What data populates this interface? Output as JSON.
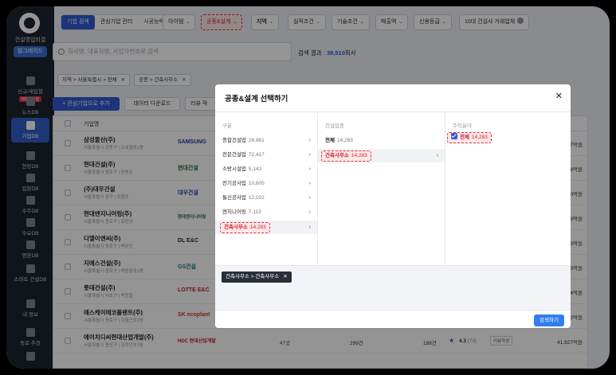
{
  "sidebar": {
    "logo_text": "건설영업비결",
    "pill": "빌그레이드",
    "items": [
      {
        "label": "신규/새입찰",
        "badge": "NEW 오늘"
      },
      {
        "label": "뉴스DB"
      },
      {
        "label": "기업DB"
      },
      {
        "label": "현장DB"
      },
      {
        "label": "입찰DB"
      },
      {
        "label": "수주DB"
      },
      {
        "label": "수요DB"
      },
      {
        "label": "평판DB"
      },
      {
        "label": "스마트 건설DB"
      },
      {
        "label": "내 정보"
      },
      {
        "label": "동료 추천"
      }
    ]
  },
  "topbar": {
    "tabs": [
      "기업 검색",
      "관심기업 관리",
      "시공능력"
    ],
    "chips": [
      "아이템",
      "공종&설계",
      "지역",
      "실적조건",
      "기술조건",
      "매출액",
      "신용등급",
      "10대 건설사 거래업체"
    ]
  },
  "search": {
    "placeholder": "회사명, 대표자명, 사업자번호로 검색",
    "result_label": "검색 결과 :",
    "result_count": "38,510",
    "result_unit": "회사"
  },
  "filters": {
    "region_tag": "지역 > 서울특별시 > 전체",
    "type_tag": "공종 > 건축사무소",
    "close": "✕"
  },
  "actions": {
    "add_interest": "+ 관심기업으로 추가",
    "download": "데이터 다운로드",
    "review": "리뷰 작"
  },
  "table": {
    "header_company": "기업명",
    "rows": [
      {
        "name": "삼성물산(주)",
        "address": "서울특별시 강동구 | 오세철외1명",
        "logo": "SAMSUNG",
        "amount": "47억원"
      },
      {
        "name": "현대건설(주)",
        "address": "서울특별시 종로구 | 윤영준",
        "logo": "현대건설",
        "amount": "88억원"
      },
      {
        "name": "(주)대우건설",
        "address": "서울특별시 중구 | 정원주",
        "logo": "대우건설",
        "amount": "40억원"
      },
      {
        "name": "현대엔지니어링(주)",
        "address": "서울특별시 종로구 | 홍현성",
        "logo": "현대엔지니어링",
        "amount": "39억원"
      },
      {
        "name": "디엘이앤씨(주)",
        "address": "서울특별시 종로구 | 박상신",
        "logo": "DL E&C",
        "amount": "73억원"
      },
      {
        "name": "지에스건설(주)",
        "address": "서울특별시 종로구 | 허윤홍외1명",
        "logo": "GS건설",
        "amount": "63억원"
      },
      {
        "name": "롯데건설(주)",
        "address": "서울특별시 서초구 | 박현철",
        "logo": "LOTTE E&C",
        "amount": "44억원"
      },
      {
        "name": "에스케이에코플랜트(주)",
        "address": "서울특별시 종로구 | 김형근외1명",
        "logo": "SK ecoplant",
        "amount": "22억원"
      },
      {
        "name": "에이치디씨현대산업개발(주)",
        "address": "서울특별시 용산구 | 김회언외1명",
        "logo": "HDC 현대산업개발",
        "amount": "41,627억원",
        "c1": "47곳",
        "c2": "299건",
        "c3": "188건",
        "rating": "4.3",
        "rating_count": "(74)",
        "review_btn": "리뷰작성"
      }
    ]
  },
  "modal": {
    "title": "공종&설계 선택하기",
    "close": "✕",
    "col1_header": "구분",
    "col2_header": "건설업종",
    "col3_header": "주력분야",
    "categories": [
      {
        "label": "종합건설업",
        "count": "28,881"
      },
      {
        "label": "전문건설업",
        "count": "72,417"
      },
      {
        "label": "소방시설업",
        "count": "5,143"
      },
      {
        "label": "전기공사업",
        "count": "10,605"
      },
      {
        "label": "통신공사업",
        "count": "12,022"
      },
      {
        "label": "엔지니어링",
        "count": "7,113"
      },
      {
        "label": "건축사무소",
        "count": "14,283"
      }
    ],
    "industries": [
      {
        "label": "전체",
        "count": "14,283"
      },
      {
        "label": "건축사무소",
        "count": "14,283"
      }
    ],
    "focus": {
      "label": "전체",
      "count": "14,283"
    },
    "selected_chip": "건축사무소 > 건축사무소",
    "search_button": "검색하기"
  }
}
